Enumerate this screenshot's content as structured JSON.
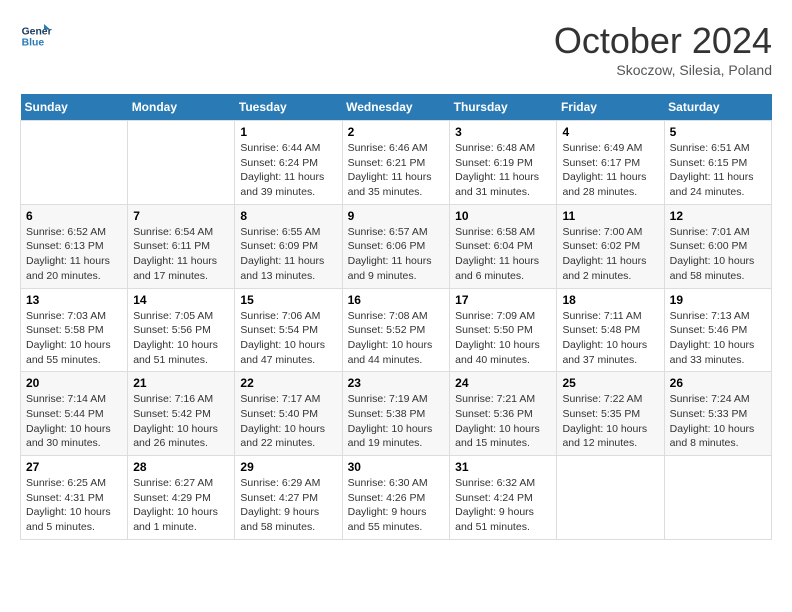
{
  "header": {
    "logo_line1": "General",
    "logo_line2": "Blue",
    "month_title": "October 2024",
    "location": "Skoczow, Silesia, Poland"
  },
  "days_of_week": [
    "Sunday",
    "Monday",
    "Tuesday",
    "Wednesday",
    "Thursday",
    "Friday",
    "Saturday"
  ],
  "weeks": [
    [
      {
        "day": "",
        "content": ""
      },
      {
        "day": "",
        "content": ""
      },
      {
        "day": "1",
        "content": "Sunrise: 6:44 AM\nSunset: 6:24 PM\nDaylight: 11 hours and 39 minutes."
      },
      {
        "day": "2",
        "content": "Sunrise: 6:46 AM\nSunset: 6:21 PM\nDaylight: 11 hours and 35 minutes."
      },
      {
        "day": "3",
        "content": "Sunrise: 6:48 AM\nSunset: 6:19 PM\nDaylight: 11 hours and 31 minutes."
      },
      {
        "day": "4",
        "content": "Sunrise: 6:49 AM\nSunset: 6:17 PM\nDaylight: 11 hours and 28 minutes."
      },
      {
        "day": "5",
        "content": "Sunrise: 6:51 AM\nSunset: 6:15 PM\nDaylight: 11 hours and 24 minutes."
      }
    ],
    [
      {
        "day": "6",
        "content": "Sunrise: 6:52 AM\nSunset: 6:13 PM\nDaylight: 11 hours and 20 minutes."
      },
      {
        "day": "7",
        "content": "Sunrise: 6:54 AM\nSunset: 6:11 PM\nDaylight: 11 hours and 17 minutes."
      },
      {
        "day": "8",
        "content": "Sunrise: 6:55 AM\nSunset: 6:09 PM\nDaylight: 11 hours and 13 minutes."
      },
      {
        "day": "9",
        "content": "Sunrise: 6:57 AM\nSunset: 6:06 PM\nDaylight: 11 hours and 9 minutes."
      },
      {
        "day": "10",
        "content": "Sunrise: 6:58 AM\nSunset: 6:04 PM\nDaylight: 11 hours and 6 minutes."
      },
      {
        "day": "11",
        "content": "Sunrise: 7:00 AM\nSunset: 6:02 PM\nDaylight: 11 hours and 2 minutes."
      },
      {
        "day": "12",
        "content": "Sunrise: 7:01 AM\nSunset: 6:00 PM\nDaylight: 10 hours and 58 minutes."
      }
    ],
    [
      {
        "day": "13",
        "content": "Sunrise: 7:03 AM\nSunset: 5:58 PM\nDaylight: 10 hours and 55 minutes."
      },
      {
        "day": "14",
        "content": "Sunrise: 7:05 AM\nSunset: 5:56 PM\nDaylight: 10 hours and 51 minutes."
      },
      {
        "day": "15",
        "content": "Sunrise: 7:06 AM\nSunset: 5:54 PM\nDaylight: 10 hours and 47 minutes."
      },
      {
        "day": "16",
        "content": "Sunrise: 7:08 AM\nSunset: 5:52 PM\nDaylight: 10 hours and 44 minutes."
      },
      {
        "day": "17",
        "content": "Sunrise: 7:09 AM\nSunset: 5:50 PM\nDaylight: 10 hours and 40 minutes."
      },
      {
        "day": "18",
        "content": "Sunrise: 7:11 AM\nSunset: 5:48 PM\nDaylight: 10 hours and 37 minutes."
      },
      {
        "day": "19",
        "content": "Sunrise: 7:13 AM\nSunset: 5:46 PM\nDaylight: 10 hours and 33 minutes."
      }
    ],
    [
      {
        "day": "20",
        "content": "Sunrise: 7:14 AM\nSunset: 5:44 PM\nDaylight: 10 hours and 30 minutes."
      },
      {
        "day": "21",
        "content": "Sunrise: 7:16 AM\nSunset: 5:42 PM\nDaylight: 10 hours and 26 minutes."
      },
      {
        "day": "22",
        "content": "Sunrise: 7:17 AM\nSunset: 5:40 PM\nDaylight: 10 hours and 22 minutes."
      },
      {
        "day": "23",
        "content": "Sunrise: 7:19 AM\nSunset: 5:38 PM\nDaylight: 10 hours and 19 minutes."
      },
      {
        "day": "24",
        "content": "Sunrise: 7:21 AM\nSunset: 5:36 PM\nDaylight: 10 hours and 15 minutes."
      },
      {
        "day": "25",
        "content": "Sunrise: 7:22 AM\nSunset: 5:35 PM\nDaylight: 10 hours and 12 minutes."
      },
      {
        "day": "26",
        "content": "Sunrise: 7:24 AM\nSunset: 5:33 PM\nDaylight: 10 hours and 8 minutes."
      }
    ],
    [
      {
        "day": "27",
        "content": "Sunrise: 6:25 AM\nSunset: 4:31 PM\nDaylight: 10 hours and 5 minutes."
      },
      {
        "day": "28",
        "content": "Sunrise: 6:27 AM\nSunset: 4:29 PM\nDaylight: 10 hours and 1 minute."
      },
      {
        "day": "29",
        "content": "Sunrise: 6:29 AM\nSunset: 4:27 PM\nDaylight: 9 hours and 58 minutes."
      },
      {
        "day": "30",
        "content": "Sunrise: 6:30 AM\nSunset: 4:26 PM\nDaylight: 9 hours and 55 minutes."
      },
      {
        "day": "31",
        "content": "Sunrise: 6:32 AM\nSunset: 4:24 PM\nDaylight: 9 hours and 51 minutes."
      },
      {
        "day": "",
        "content": ""
      },
      {
        "day": "",
        "content": ""
      }
    ]
  ]
}
